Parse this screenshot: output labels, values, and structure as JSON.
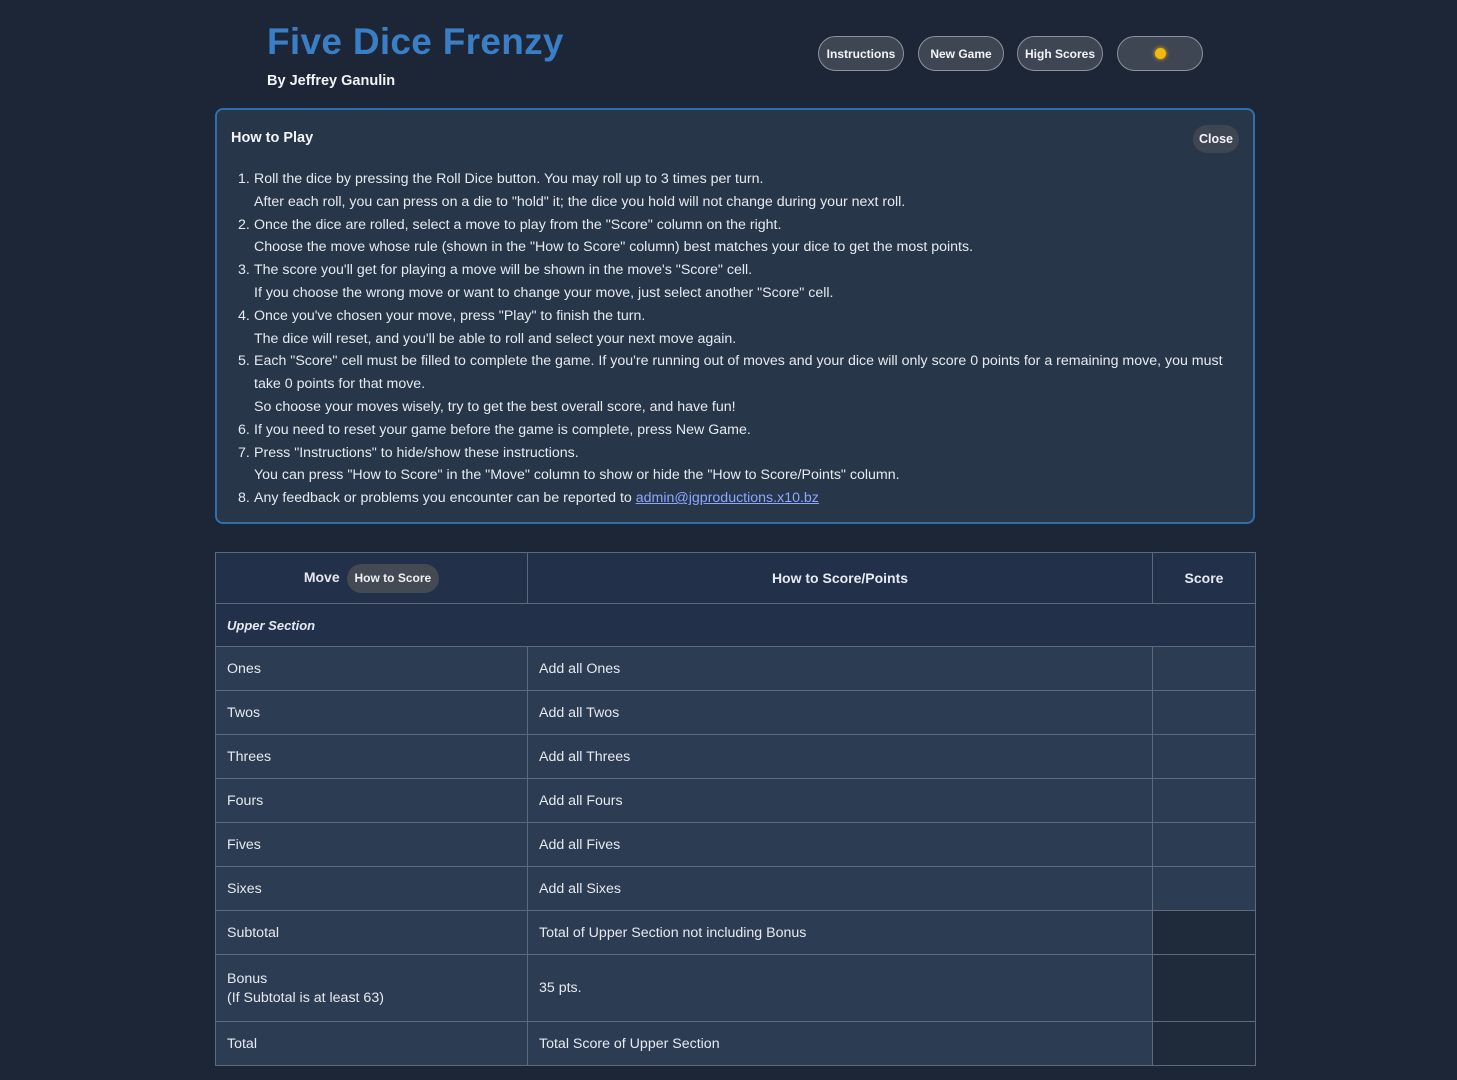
{
  "header": {
    "title": "Five Dice Frenzy",
    "author": "By Jeffrey Ganulin",
    "buttons": {
      "instructions": "Instructions",
      "new_game": "New Game",
      "high_scores": "High Scores",
      "theme_icon": "sun-icon"
    }
  },
  "how_to_play": {
    "title": "How to Play",
    "close_label": "Close",
    "steps": [
      {
        "num": "1.",
        "lines": [
          "Roll the dice by pressing the Roll Dice button. You may roll up to 3 times per turn.",
          "After each roll, you can press on a die to \"hold\" it; the dice you hold will not change during your next roll."
        ]
      },
      {
        "num": "2.",
        "lines": [
          "Once the dice are rolled, select a move to play from the \"Score\" column on the right.",
          "Choose the move whose rule (shown in the \"How to Score\" column) best matches your dice to get the most points."
        ]
      },
      {
        "num": "3.",
        "lines": [
          "The score you'll get for playing a move will be shown in the move's \"Score\" cell.",
          "If you choose the wrong move or want to change your move, just select another \"Score\" cell."
        ]
      },
      {
        "num": "4.",
        "lines": [
          "Once you've chosen your move, press \"Play\" to finish the turn.",
          "The dice will reset, and you'll be able to roll and select your next move again."
        ]
      },
      {
        "num": "5.",
        "lines": [
          "Each \"Score\" cell must be filled to complete the game. If you're running out of moves and your dice will only score 0 points for a remaining move, you must take 0 points for that move.",
          "So choose your moves wisely, try to get the best overall score, and have fun!"
        ]
      },
      {
        "num": "6.",
        "lines": [
          "If you need to reset your game before the game is complete, press New Game."
        ]
      },
      {
        "num": "7.",
        "lines": [
          "Press \"Instructions\" to hide/show these instructions.",
          "You can press \"How to Score\" in the \"Move\" column to show or hide the \"How to Score/Points\" column."
        ]
      },
      {
        "num": "8.",
        "lines": [
          "Any feedback or problems you encounter can be reported to "
        ],
        "link": "admin@jgproductions.x10.bz"
      }
    ]
  },
  "table": {
    "headers": {
      "move": "Move",
      "how_to_score_button": "How to Score",
      "how_to_score_points": "How to Score/Points",
      "score": "Score"
    },
    "section_title": "Upper Section",
    "rows": [
      {
        "move": "Ones",
        "rule": "Add all Ones",
        "score": ""
      },
      {
        "move": "Twos",
        "rule": "Add all Twos",
        "score": ""
      },
      {
        "move": "Threes",
        "rule": "Add all Threes",
        "score": ""
      },
      {
        "move": "Fours",
        "rule": "Add all Fours",
        "score": ""
      },
      {
        "move": "Fives",
        "rule": "Add all Fives",
        "score": ""
      },
      {
        "move": "Sixes",
        "rule": "Add all Sixes",
        "score": ""
      },
      {
        "move": "Subtotal",
        "rule": "Total of Upper Section not including Bonus",
        "score": ""
      },
      {
        "move": "Bonus",
        "move_note": "(If Subtotal is at least 63)",
        "rule": "35 pts.",
        "score": ""
      },
      {
        "move": "Total",
        "rule": "Total Score of Upper Section",
        "score": ""
      }
    ]
  }
}
